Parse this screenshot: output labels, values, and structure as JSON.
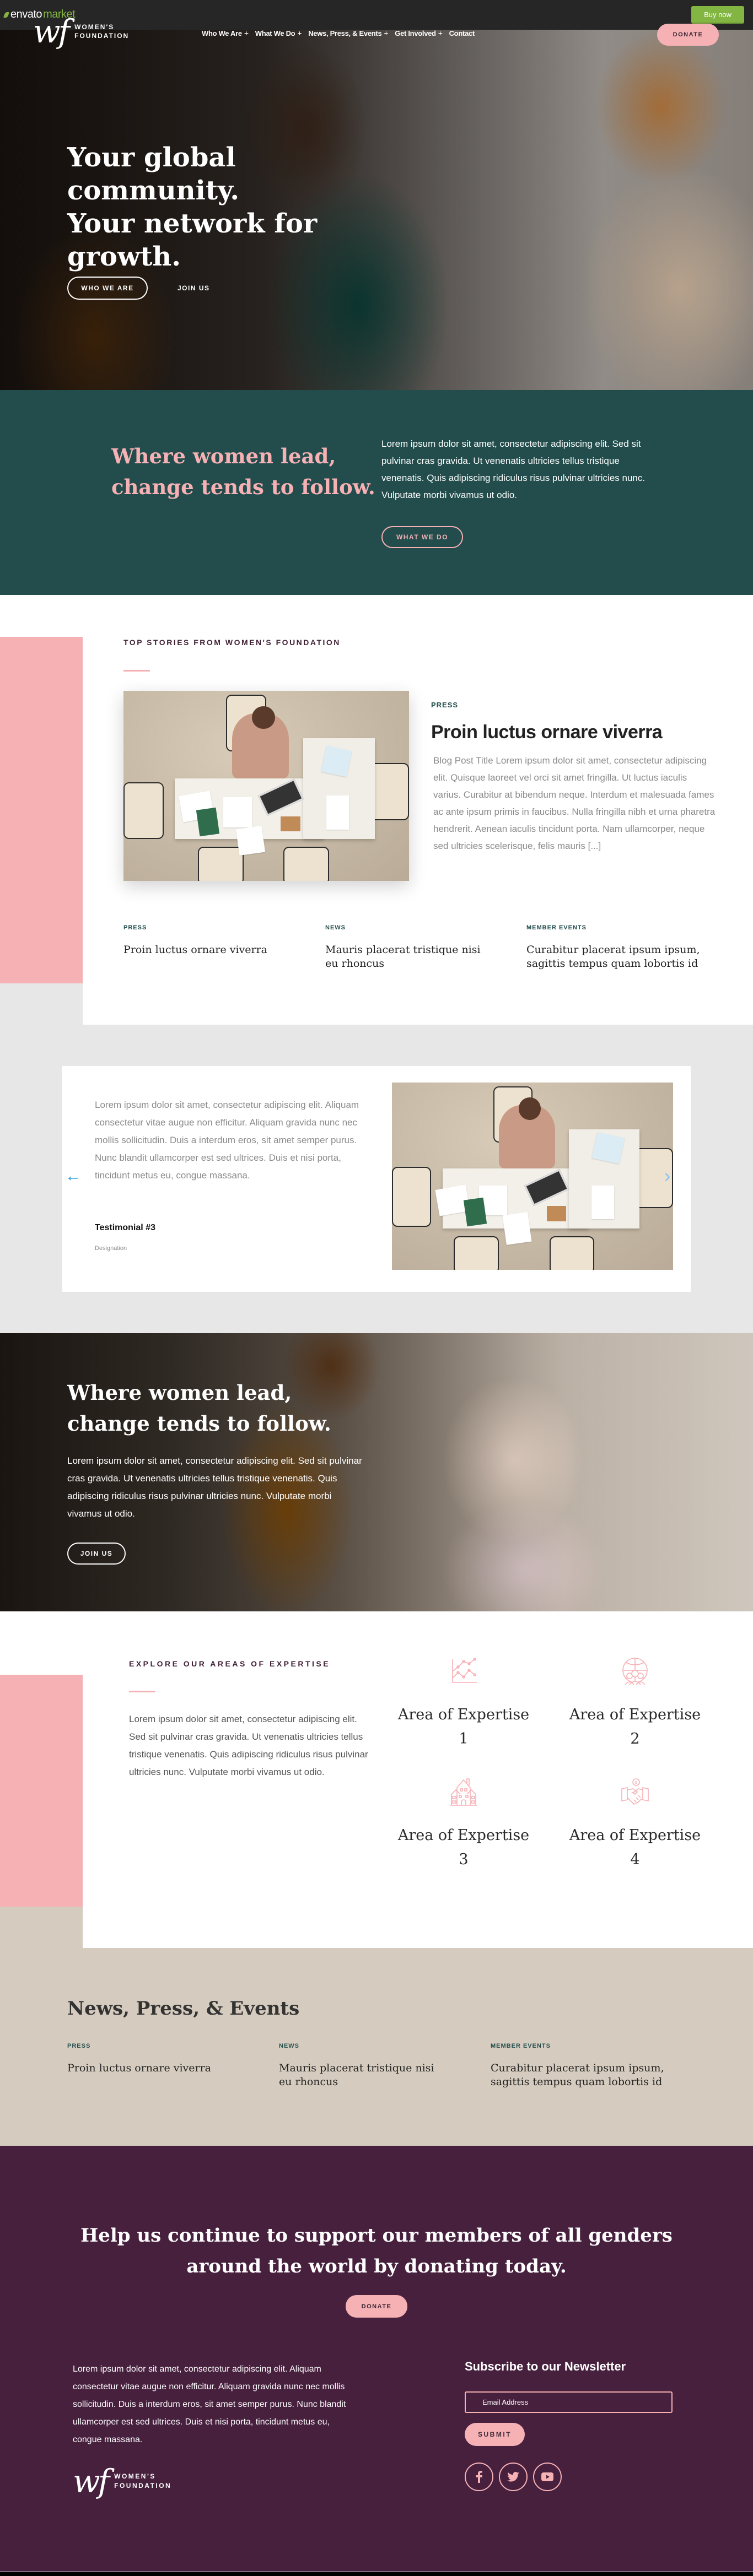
{
  "envato": {
    "logo_prefix": "envato",
    "logo_suffix": "market",
    "buy_now": "Buy now"
  },
  "header": {
    "logo_mark": "wf",
    "logo_line1": "WOMEN'S",
    "logo_line2": "FOUNDATION",
    "nav": [
      {
        "label": "Who We Are",
        "has_submenu": true
      },
      {
        "label": "What We Do",
        "has_submenu": true
      },
      {
        "label": "News, Press, & Events",
        "has_submenu": true
      },
      {
        "label": "Get Involved",
        "has_submenu": true
      },
      {
        "label": "Contact",
        "has_submenu": false
      }
    ],
    "submenu_glyph": "+",
    "donate": "DONATE"
  },
  "hero": {
    "title_line1": "Your global community.",
    "title_line2": "Your network for growth.",
    "primary_button": "WHO WE ARE",
    "secondary_link": "JOIN US"
  },
  "intro": {
    "heading": "Where women lead, change tends to follow.",
    "text": "Lorem ipsum dolor sit amet, consectetur adipiscing elit. Sed sit pulvinar cras gravida. Ut venenatis ultricies tellus tristique venenatis. Quis adipiscing ridiculus risus pulvinar ultricies nunc. Vulputate morbi vivamus ut odio.",
    "button": "WHAT WE DO"
  },
  "top_stories": {
    "label": "TOP STORIES FROM WOMEN'S FOUNDATION",
    "featured": {
      "category": "PRESS",
      "title": "Proin luctus ornare viverra",
      "excerpt": "Blog Post Title Lorem ipsum dolor sit amet, consectetur adipiscing elit. Quisque laoreet vel orci sit amet fringilla. Ut luctus iaculis varius. Curabitur at bibendum neque. Interdum et malesuada fames ac ante ipsum primis in faucibus. Nulla fringilla nibh et urna pharetra hendrerit. Aenean iaculis tincidunt porta. Nam ullamcorper, neque sed ultricies scelerisque, felis mauris [...]"
    },
    "posts": [
      {
        "category": "PRESS",
        "title": "Proin luctus ornare viverra"
      },
      {
        "category": "NEWS",
        "title": "Mauris placerat tristique nisi eu rhoncus"
      },
      {
        "category": "MEMBER EVENTS",
        "title": "Curabitur placerat ipsum ipsum, sagittis tempus quam lobortis id"
      }
    ]
  },
  "testimonial": {
    "quote": "Lorem ipsum dolor sit amet, consectetur adipiscing elit. Aliquam consectetur vitae augue non efficitur. Aliquam gravida nunc nec mollis sollicitudin. Duis a interdum eros, sit amet semper purus. Nunc blandit ullamcorper est sed ultrices. Duis et nisi porta, tincidunt metus eu, congue massana.",
    "name": "Testimonial #3",
    "designation": "Designation",
    "prev_icon": "←",
    "next_icon": "›"
  },
  "cta": {
    "heading": "Where women lead, change tends to follow.",
    "text": "Lorem ipsum dolor sit amet, consectetur adipiscing elit. Sed sit pulvinar cras gravida. Ut venenatis ultricies tellus tristique venenatis. Quis adipiscing ridiculus risus pulvinar ultricies nunc. Vulputate morbi vivamus ut odio.",
    "button": "JOIN US"
  },
  "expertise": {
    "label": "EXPLORE OUR AREAS OF EXPERTISE",
    "text": "Lorem ipsum dolor sit amet, consectetur adipiscing elit. Sed sit pulvinar cras gravida. Ut venenatis ultricies tellus tristique venenatis. Quis adipiscing ridiculus risus pulvinar ultricies nunc. Vulputate morbi vivamus ut odio.",
    "areas": [
      {
        "title": "Area of Expertise 1",
        "icon": "line-chart-icon"
      },
      {
        "title": "Area of Expertise 2",
        "icon": "global-community-icon"
      },
      {
        "title": "Area of Expertise 3",
        "icon": "building-icon"
      },
      {
        "title": "Area of Expertise 4",
        "icon": "handshake-money-icon"
      }
    ],
    "icon_color": "#f6b1b5"
  },
  "news": {
    "title": "News, Press, & Events",
    "posts": [
      {
        "category": "PRESS",
        "title": "Proin luctus ornare viverra"
      },
      {
        "category": "NEWS",
        "title": "Mauris placerat tristique nisi eu rhoncus"
      },
      {
        "category": "MEMBER EVENTS",
        "title": "Curabitur placerat ipsum ipsum, sagittis tempus quam lobortis id"
      }
    ]
  },
  "footer": {
    "donate_heading": "Help us continue to support our members of all genders around the world by donating today.",
    "donate_button": "DONATE",
    "text": "Lorem ipsum dolor sit amet, consectetur adipiscing elit. Aliquam consectetur vitae augue non efficitur. Aliquam gravida nunc nec mollis sollicitudin. Duis a interdum eros, sit amet semper purus. Nunc blandit ullamcorper est sed ultrices. Duis et nisi porta, tincidunt metus eu, congue massana.",
    "logo_mark": "wf",
    "logo_line1": "WOMEN'S",
    "logo_line2": "FOUNDATION",
    "newsletter_title": "Subscribe to our Newsletter",
    "email_placeholder": "Email Address",
    "submit": "SUBMIT",
    "social": [
      "facebook",
      "twitter",
      "youtube"
    ]
  },
  "colors": {
    "brand_green": "#224d4c",
    "brand_pink": "#f6b1b5",
    "brand_purple": "#47203e",
    "beige": "#d5ccbf",
    "light_grey": "#e7e7e7",
    "envato_green": "#82b541",
    "arrow_blue": "#2b9cd8"
  }
}
